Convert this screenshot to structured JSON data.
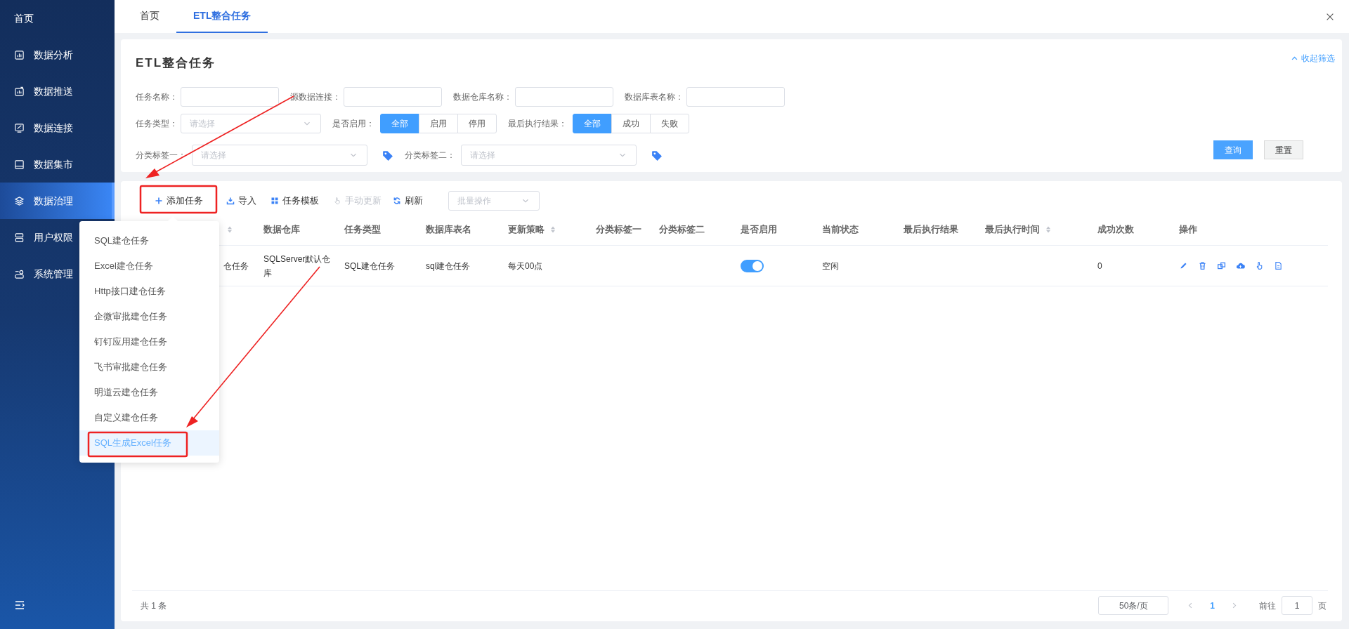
{
  "sidebar": {
    "home": "首页",
    "items": [
      {
        "label": "数据分析",
        "selected": false
      },
      {
        "label": "数据推送",
        "selected": false
      },
      {
        "label": "数据连接",
        "selected": false
      },
      {
        "label": "数据集市",
        "selected": false
      },
      {
        "label": "数据治理",
        "selected": true
      },
      {
        "label": "用户权限",
        "selected": false
      },
      {
        "label": "系统管理",
        "selected": false
      }
    ]
  },
  "tabs": [
    {
      "label": "首页",
      "selected": false
    },
    {
      "label": "ETL整合任务",
      "selected": true
    }
  ],
  "filter": {
    "title": "ETL整合任务",
    "collapse_link": "收起筛选",
    "text_fields": [
      {
        "label": "任务名称："
      },
      {
        "label": "源数据连接："
      },
      {
        "label": "数据仓库名称："
      },
      {
        "label": "数据库表名称："
      }
    ],
    "task_type": {
      "label": "任务类型：",
      "placeholder": "请选择"
    },
    "toggles": [
      {
        "label": "是否启用：",
        "options": [
          {
            "label": "全部",
            "selected": true
          },
          {
            "label": "启用",
            "selected": false
          },
          {
            "label": "停用",
            "selected": false
          }
        ]
      },
      {
        "label": "最后执行结果：",
        "options": [
          {
            "label": "全部",
            "selected": true
          },
          {
            "label": "成功",
            "selected": false
          },
          {
            "label": "失败",
            "selected": false
          }
        ]
      }
    ],
    "tag_selects": [
      {
        "label": "分类标签一：",
        "placeholder": "请选择"
      },
      {
        "label": "分类标签二：",
        "placeholder": "请选择"
      }
    ],
    "buttons": [
      {
        "label": "查询",
        "kind": "primary"
      },
      {
        "label": "重置",
        "kind": "default"
      }
    ]
  },
  "toolbar": {
    "actions": [
      {
        "label": "添加任务",
        "disabled": false
      },
      {
        "label": "导入",
        "disabled": false
      },
      {
        "label": "任务模板",
        "disabled": false
      },
      {
        "label": "手动更新",
        "disabled": true
      },
      {
        "label": "刷新",
        "disabled": false
      }
    ],
    "batch_select": {
      "placeholder": "批量操作"
    }
  },
  "table": {
    "columns": [
      {
        "sortable": true
      },
      {
        "label": "数据仓库",
        "sortable": false
      },
      {
        "label": "任务类型",
        "sortable": false
      },
      {
        "label": "数据库表名",
        "sortable": false
      },
      {
        "label": "更新策略",
        "sortable": true
      },
      {
        "label": "分类标签一",
        "sortable": false
      },
      {
        "label": "分类标签二",
        "sortable": false
      },
      {
        "label": "是否启用",
        "sortable": false
      },
      {
        "label": "当前状态",
        "sortable": false
      },
      {
        "label": "最后执行结果",
        "sortable": false
      },
      {
        "label": "最后执行时间",
        "sortable": true
      },
      {
        "label": "成功次数",
        "sortable": false
      },
      {
        "label": "操作",
        "sortable": false
      }
    ],
    "rows": [
      {
        "column_1": "仓任务",
        "warehouse": "SQLServer默认仓库",
        "task_type": "SQL建仓任务",
        "table_name": "sql建仓任务",
        "update_policy": "每天00点",
        "enabled": true,
        "status": "空闲",
        "success_count": "0"
      }
    ]
  },
  "add_menu": {
    "items": [
      {
        "label": "SQL建仓任务",
        "selected": false
      },
      {
        "label": "Excel建仓任务",
        "selected": false
      },
      {
        "label": "Http接口建仓任务",
        "selected": false
      },
      {
        "label": "企微审批建仓任务",
        "selected": false
      },
      {
        "label": "钉钉应用建仓任务",
        "selected": false
      },
      {
        "label": "飞书审批建仓任务",
        "selected": false
      },
      {
        "label": "明道云建仓任务",
        "selected": false
      },
      {
        "label": "自定义建仓任务",
        "selected": false
      },
      {
        "label": "SQL生成Excel任务",
        "selected": true
      }
    ]
  },
  "pagination": {
    "total": "共 1 条",
    "page_size": "50条/页",
    "pages": [
      {
        "label": "1",
        "selected": true
      }
    ],
    "goto_label": "前往",
    "goto_value": "1",
    "page_suffix": "页"
  }
}
